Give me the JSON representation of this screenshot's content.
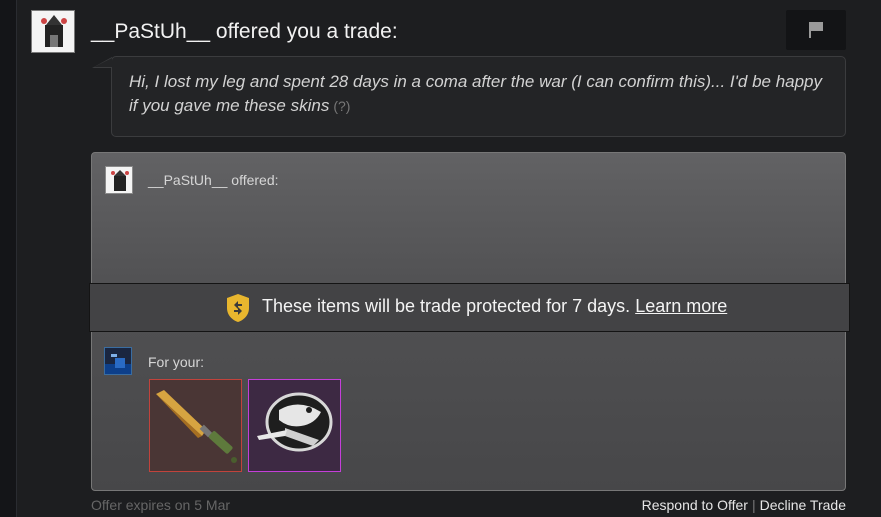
{
  "header": {
    "partner_name": "__PaStUh__",
    "title_suffix": " offered you a trade:"
  },
  "message": {
    "text": "Hi, I lost my leg and spent 28 days in a coma after the war (I can confirm this)... I'd be happy if you gave me these skins",
    "help_mark": "(?)"
  },
  "offer": {
    "offered_label": "__PaStUh__ offered:",
    "protection_text": "These items will be trade protected for 7 days. ",
    "learn_more": "Learn more",
    "for_your_label": "For your:",
    "items": [
      {
        "name": "knife",
        "rarity_color": "#c1433c"
      },
      {
        "name": "sticker",
        "rarity_color": "#c43fd9"
      }
    ]
  },
  "footer": {
    "expires": "Offer expires on 5 Mar",
    "respond": "Respond to Offer",
    "separator": "|",
    "decline": "Decline Trade"
  },
  "icons": {
    "flag": "flag-icon",
    "shield": "trade-protect-shield-icon"
  }
}
